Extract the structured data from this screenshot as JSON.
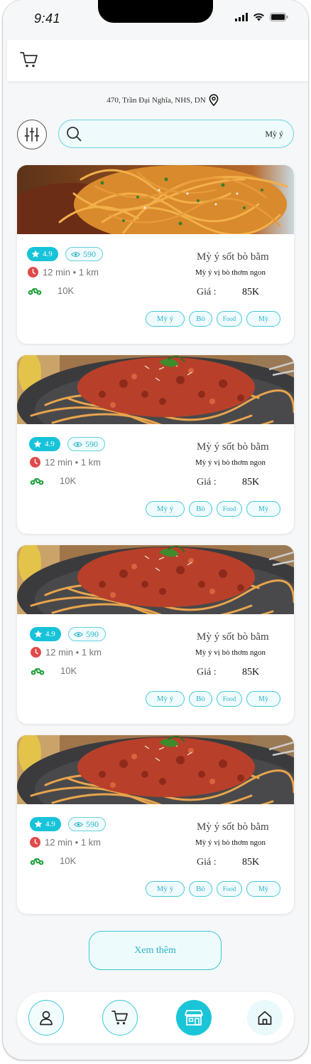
{
  "status_bar": {
    "time": "9:41"
  },
  "location": {
    "address": "470, Trần Đại Nghĩa, NHS, DN"
  },
  "search": {
    "value": "Mỳ ý"
  },
  "foods": [
    {
      "rating": "4.9",
      "views": "590",
      "time": "12 min",
      "distance": "1 km",
      "ship_fee": "10K",
      "name": "Mỳ ý sốt bò bằm",
      "description": "Mỳ ý vị bò thơm ngon",
      "price_label": "Giá :",
      "price": "85K",
      "tags": [
        "Mỳ ý",
        "Bò",
        "Food",
        "Mỳ"
      ]
    },
    {
      "rating": "4.9",
      "views": "590",
      "time": "12 min",
      "distance": "1 km",
      "ship_fee": "10K",
      "name": "Mỳ ý sốt bò bằm",
      "description": "Mỳ ý vị bò thơm ngon",
      "price_label": "Giá :",
      "price": "85K",
      "tags": [
        "Mỳ ý",
        "Bò",
        "Food",
        "Mỳ"
      ]
    },
    {
      "rating": "4.9",
      "views": "590",
      "time": "12 min",
      "distance": "1 km",
      "ship_fee": "10K",
      "name": "Mỳ ý sốt bò bằm",
      "description": "Mỳ ý vị bò thơm ngon",
      "price_label": "Giá :",
      "price": "85K",
      "tags": [
        "Mỳ ý",
        "Bò",
        "Food",
        "Mỳ"
      ]
    },
    {
      "rating": "4.9",
      "views": "590",
      "time": "12 min",
      "distance": "1 km",
      "ship_fee": "10K",
      "name": "Mỳ ý sốt bò bằm",
      "description": "Mỳ ý vị bò thơm ngon",
      "price_label": "Giá :",
      "price": "85K",
      "tags": [
        "Mỳ ý",
        "Bò",
        "Food",
        "Mỳ"
      ]
    }
  ],
  "load_more": {
    "label": "Xem thêm"
  },
  "bottom_nav": {
    "items": [
      "profile-icon",
      "cart-icon",
      "store-icon",
      "home-icon"
    ],
    "active": "store-icon"
  },
  "colors": {
    "accent": "#1bc5d9",
    "clock": "#e04a4a",
    "bike": "#21a33b"
  },
  "header": {
    "icon": "cart-icon"
  }
}
